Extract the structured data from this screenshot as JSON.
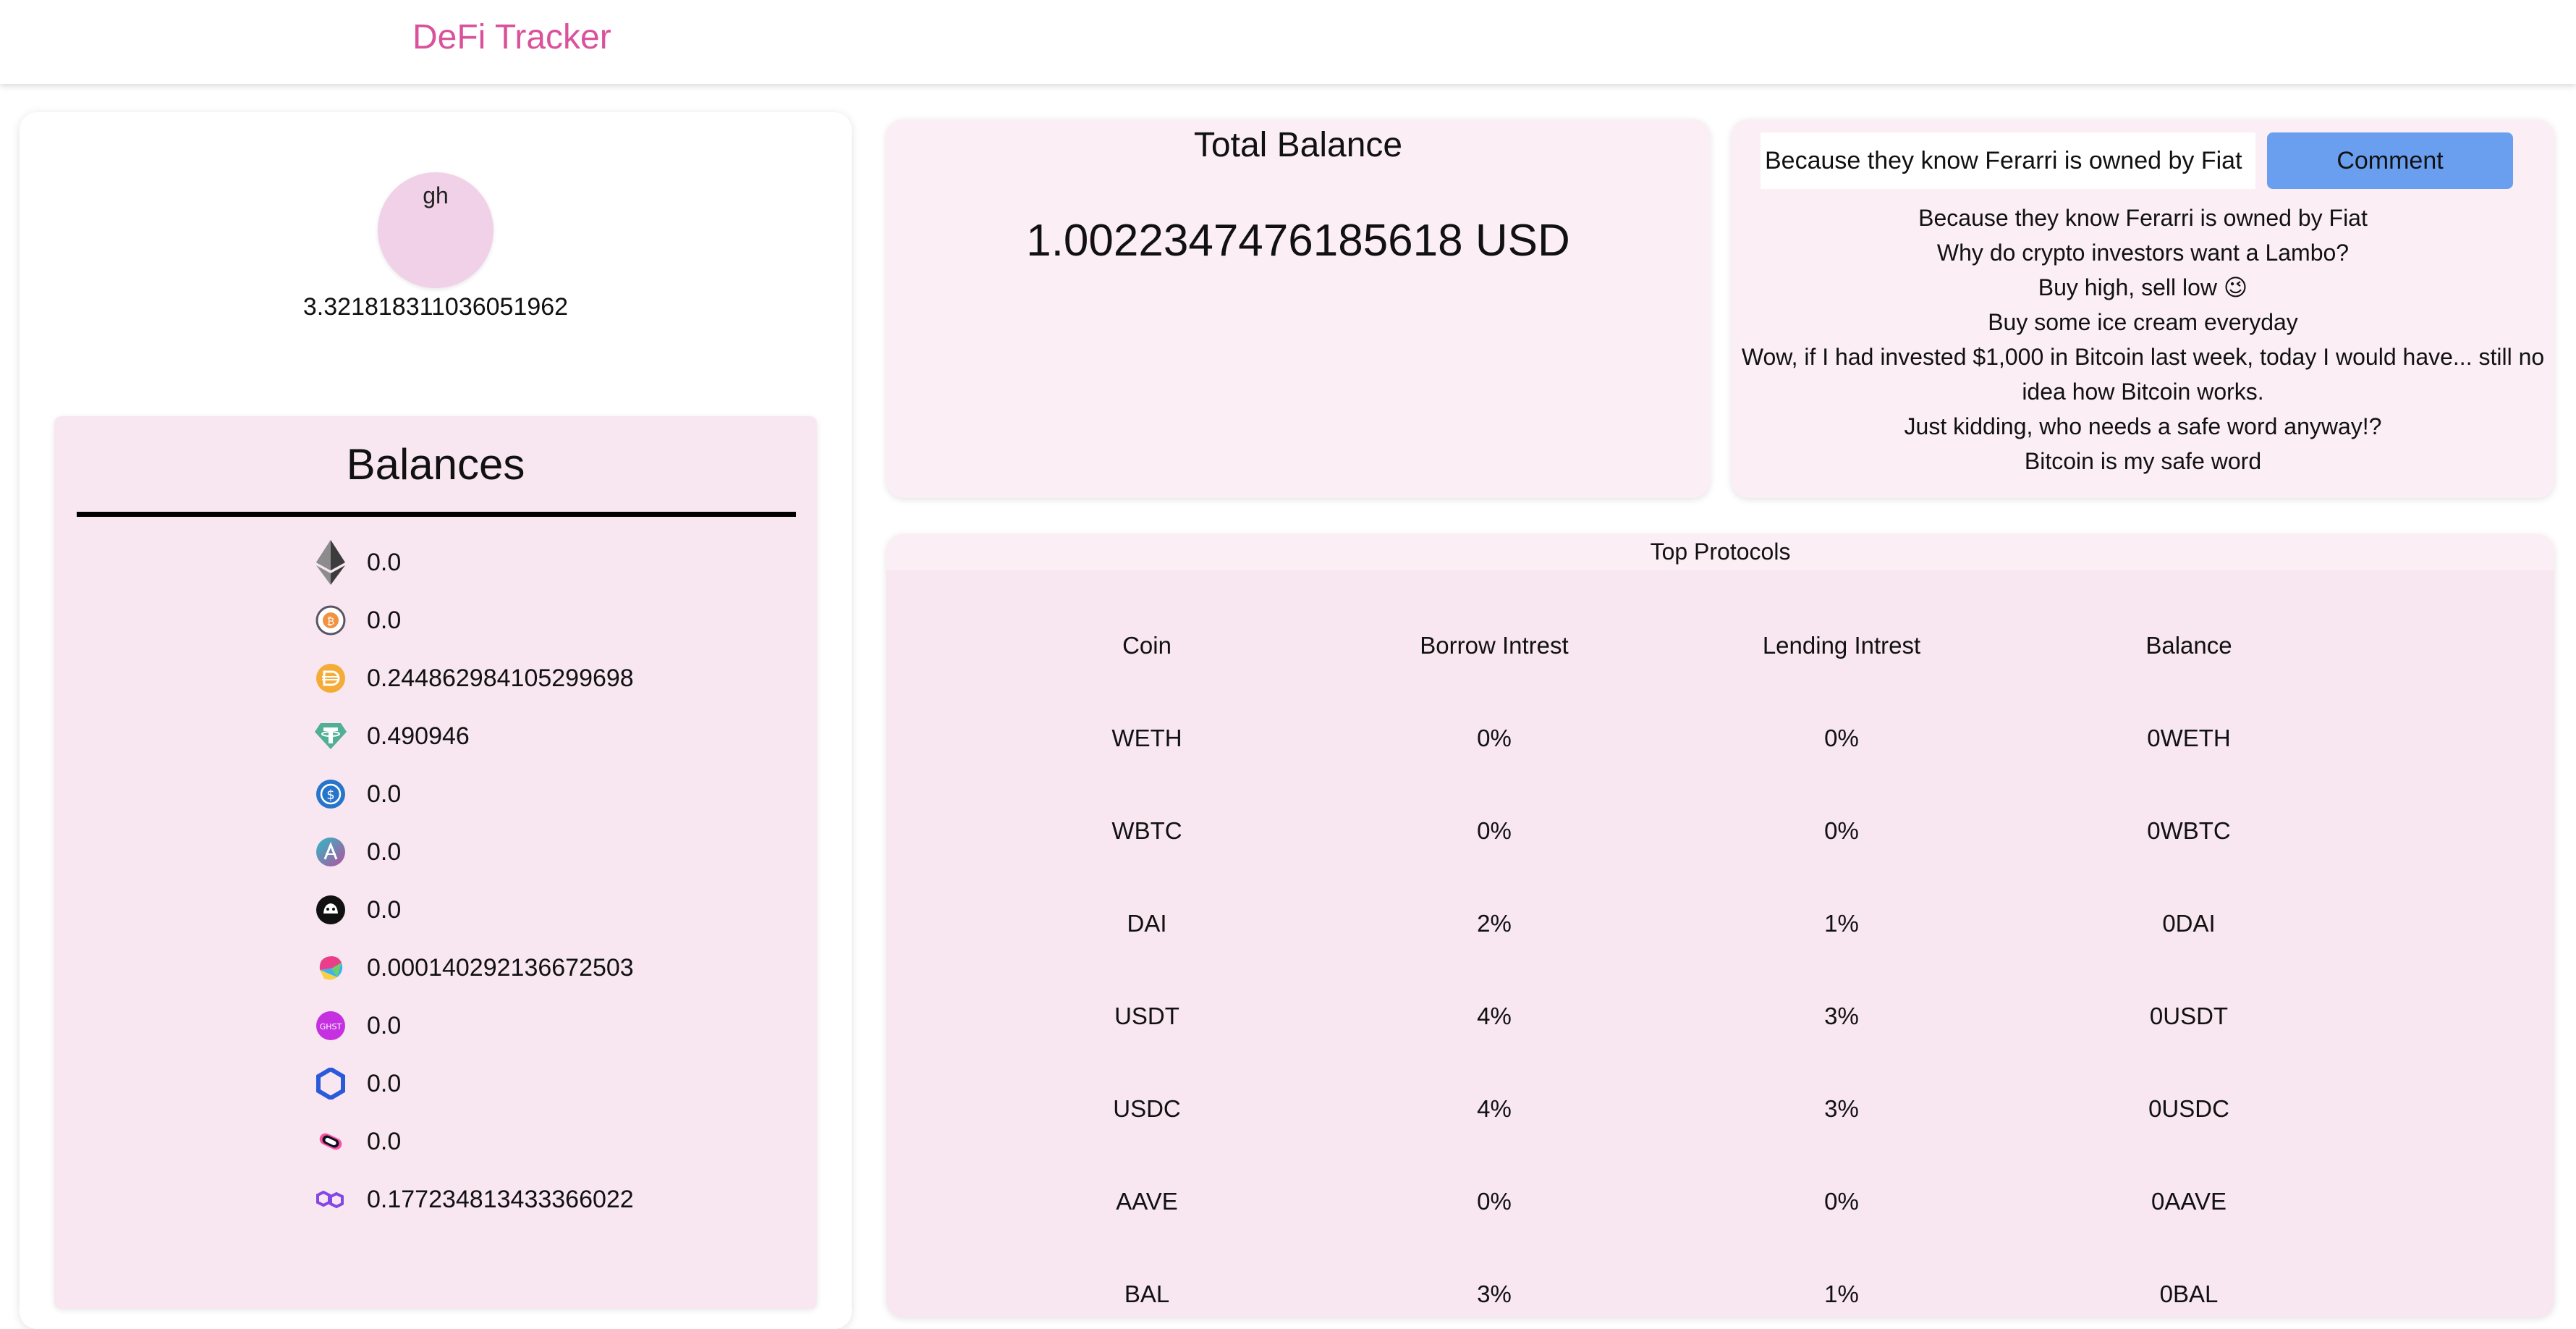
{
  "header": {
    "brand": "DeFi Tracker"
  },
  "profile": {
    "avatar_text": "gh",
    "balance_value": "3.321818311036051962"
  },
  "balances": {
    "title": "Balances",
    "items": [
      {
        "icon": "ethereum-icon",
        "value": "0.0"
      },
      {
        "icon": "wbtc-icon",
        "value": "0.0"
      },
      {
        "icon": "dai-icon",
        "value": "0.244862984105299698"
      },
      {
        "icon": "tether-icon",
        "value": "0.490946"
      },
      {
        "icon": "usdc-icon",
        "value": "0.0"
      },
      {
        "icon": "aave-icon",
        "value": "0.0"
      },
      {
        "icon": "uniswap-icon",
        "value": "0.0"
      },
      {
        "icon": "balancer-icon",
        "value": "0.000140292136672503"
      },
      {
        "icon": "ghst-icon",
        "value": "0.0"
      },
      {
        "icon": "chainlink-icon",
        "value": "0.0"
      },
      {
        "icon": "sushi-icon",
        "value": "0.0"
      },
      {
        "icon": "polygon-icon",
        "value": "0.177234813433366022"
      }
    ]
  },
  "total": {
    "title": "Total Balance",
    "value": "1.0022347476185618 USD"
  },
  "comments": {
    "input_value": "Because they know Ferarri is owned by Fiat",
    "button_label": "Comment",
    "items": [
      "Because they know Ferarri is owned by Fiat",
      "Why do crypto investors want a Lambo?",
      "Buy high, sell low 😉",
      "Buy some ice cream everyday",
      "Wow, if I had invested $1,000 in Bitcoin last week, today I would have... still no idea how Bitcoin works.",
      "Just kidding, who needs a safe word anyway!?",
      "Bitcoin is my safe word"
    ]
  },
  "protocols": {
    "title": "Top Protocols",
    "columns": [
      "Coin",
      "Borrow Intrest",
      "Lending Intrest",
      "Balance"
    ],
    "rows": [
      [
        "WETH",
        "0%",
        "0%",
        "0WETH"
      ],
      [
        "WBTC",
        "0%",
        "0%",
        "0WBTC"
      ],
      [
        "DAI",
        "2%",
        "1%",
        "0DAI"
      ],
      [
        "USDT",
        "4%",
        "3%",
        "0USDT"
      ],
      [
        "USDC",
        "4%",
        "3%",
        "0USDC"
      ],
      [
        "AAVE",
        "0%",
        "0%",
        "0AAVE"
      ],
      [
        "BAL",
        "3%",
        "1%",
        "0BAL"
      ]
    ]
  }
}
